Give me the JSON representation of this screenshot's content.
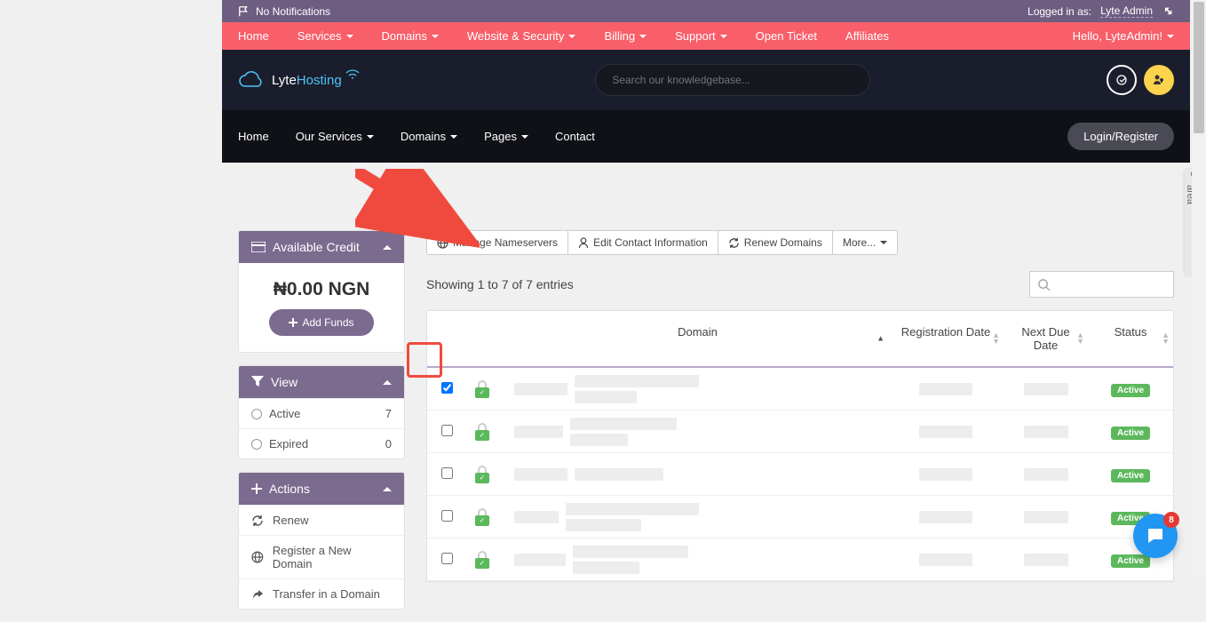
{
  "topbar": {
    "notifications": "No Notifications",
    "logged_label": "Logged in as:",
    "username": "Lyte Admin"
  },
  "pinkbar": {
    "items": [
      "Home",
      "Services",
      "Domains",
      "Website & Security",
      "Billing",
      "Support",
      "Open Ticket",
      "Affiliates"
    ],
    "greeting": "Hello, LyteAdmin!"
  },
  "darkbar": {
    "search_placeholder": "Search our knowledgebase..."
  },
  "navbar": {
    "items": [
      "Home",
      "Our Services",
      "Domains",
      "Pages",
      "Contact"
    ],
    "login": "Login/Register"
  },
  "sidebar": {
    "credit": {
      "title": "Available Credit",
      "amount": "₦0.00 NGN",
      "add_funds": "Add Funds"
    },
    "view": {
      "title": "View",
      "items": [
        {
          "label": "Active",
          "count": "7"
        },
        {
          "label": "Expired",
          "count": "0"
        }
      ]
    },
    "actions": {
      "title": "Actions",
      "items": [
        "Renew",
        "Register a New Domain",
        "Transfer in a Domain"
      ]
    }
  },
  "buttons": {
    "manage_ns": "Manage Nameservers",
    "edit_contact": "Edit Contact Information",
    "renew": "Renew Domains",
    "more": "More..."
  },
  "showing": "Showing 1 to 7 of 7 entries",
  "table": {
    "headers": {
      "domain": "Domain",
      "reg": "Registration Date",
      "due": "Next Due Date",
      "status": "Status"
    },
    "rows": [
      {
        "checked": true,
        "status": "Active"
      },
      {
        "checked": false,
        "status": "Active"
      },
      {
        "checked": false,
        "status": "Active"
      },
      {
        "checked": false,
        "status": "Active"
      },
      {
        "checked": false,
        "status": "Active"
      }
    ]
  },
  "right_widget": "Return to admin area",
  "chat_badge": "8"
}
